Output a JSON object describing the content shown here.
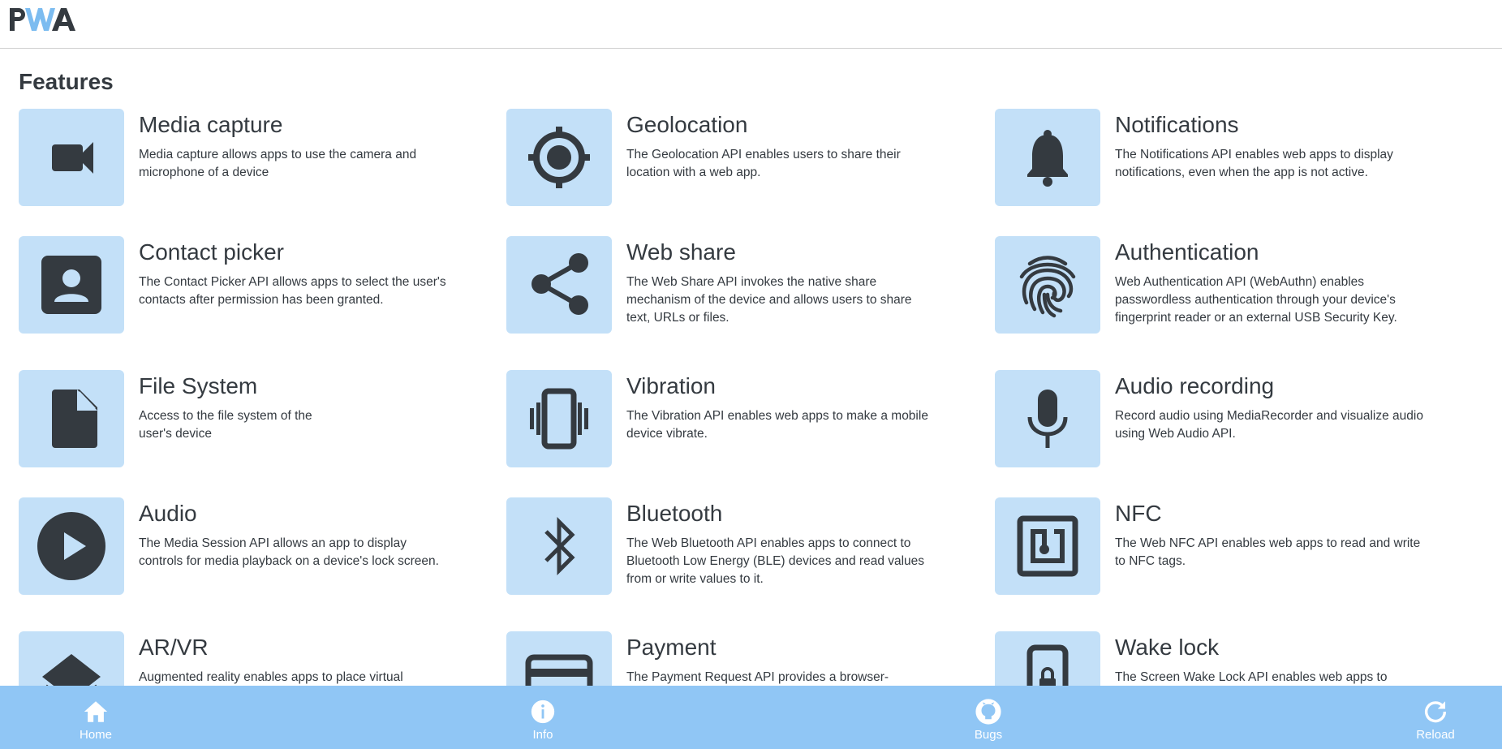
{
  "header": {
    "logo_text": "PWA"
  },
  "main": {
    "section_title": "Features",
    "features": [
      {
        "title": "Media capture",
        "description": "Media capture allows apps to use the camera and microphone of a device",
        "icon": "video-camera-icon"
      },
      {
        "title": "Geolocation",
        "description": "The Geolocation API enables users to share their location with a web app.",
        "icon": "crosshair-icon"
      },
      {
        "title": "Notifications",
        "description": "The Notifications API enables web apps to display notifications, even when the app is not active.",
        "icon": "bell-icon"
      },
      {
        "title": "Contact picker",
        "description": "The Contact Picker API allows apps to select the user's contacts after permission has been granted.",
        "icon": "contact-icon"
      },
      {
        "title": "Web share",
        "description": "The Web Share API invokes the native share mechanism of the device and allows users to share text, URLs or files.",
        "icon": "share-icon"
      },
      {
        "title": "Authentication",
        "description": "Web Authentication API (WebAuthn) enables passwordless authentication through your device's fingerprint reader or an external USB Security Key.",
        "icon": "fingerprint-icon"
      },
      {
        "title": "File System",
        "description": "Access to the file system of the user's device",
        "icon": "file-icon"
      },
      {
        "title": "Vibration",
        "description": "The Vibration API enables web apps to make a mobile device vibrate.",
        "icon": "vibration-icon"
      },
      {
        "title": "Audio recording",
        "description": "Record audio using MediaRecorder and visualize audio using Web Audio API.",
        "icon": "microphone-icon"
      },
      {
        "title": "Audio",
        "description": "The Media Session API allows an app to display controls for media playback on a device's lock screen.",
        "icon": "play-circle-icon"
      },
      {
        "title": "Bluetooth",
        "description": "The Web Bluetooth API enables apps to connect to Bluetooth Low Energy (BLE) devices and read values from or write values to it.",
        "icon": "bluetooth-icon"
      },
      {
        "title": "NFC",
        "description": "The Web NFC API enables web apps to read and write to NFC tags.",
        "icon": "nfc-icon"
      },
      {
        "title": "AR/VR",
        "description": "Augmented reality enables apps to place virtual",
        "icon": "layers-icon"
      },
      {
        "title": "Payment",
        "description": "The Payment Request API provides a browser-",
        "icon": "credit-card-icon"
      },
      {
        "title": "Wake lock",
        "description": "The Screen Wake Lock API enables web apps to",
        "icon": "phone-lock-icon"
      }
    ]
  },
  "bottom_nav": {
    "items": [
      {
        "label": "Home",
        "icon": "home-icon"
      },
      {
        "label": "Info",
        "icon": "info-icon"
      },
      {
        "label": "Bugs",
        "icon": "github-icon"
      },
      {
        "label": "Reload",
        "icon": "reload-icon"
      }
    ]
  },
  "colors": {
    "tile_background": "#c3e0f8",
    "nav_background": "#90c6f5",
    "icon_dark": "#343a40",
    "logo_blue": "#7cbcf0"
  }
}
